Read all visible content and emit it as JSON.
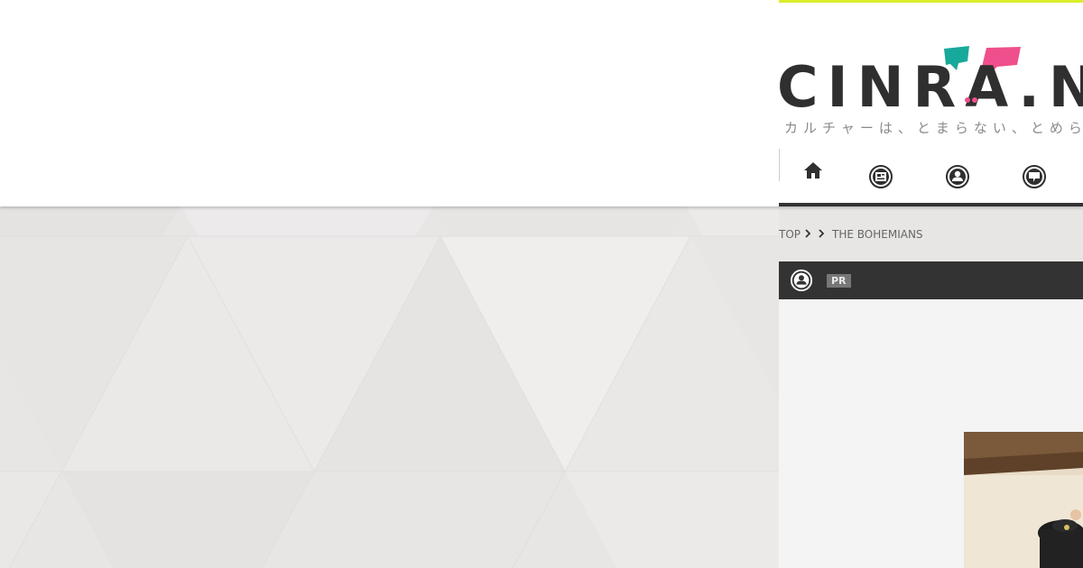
{
  "colors": {
    "accent_bar": "#d9ef2b",
    "logo_text": "#2f2f2f",
    "bubble_teal": "#17a99b",
    "bubble_pink": "#ef4f8c",
    "dark_bar": "#333333",
    "pr_badge": "#777777",
    "page_bg": "#e8e7e6"
  },
  "site": {
    "logo_text": "CINRA.NET",
    "tagline": "カルチャーは、とまらない、とめらない"
  },
  "nav": {
    "items": [
      {
        "name": "home",
        "icon": "home-icon"
      },
      {
        "name": "news",
        "icon": "news-icon"
      },
      {
        "name": "interview",
        "icon": "person-icon"
      },
      {
        "name": "column",
        "icon": "chat-icon"
      }
    ]
  },
  "breadcrumb": {
    "items": [
      "TOP",
      "THE BOHEMIANS"
    ]
  },
  "article": {
    "category_icon": "person-icon",
    "badge": "PR"
  }
}
